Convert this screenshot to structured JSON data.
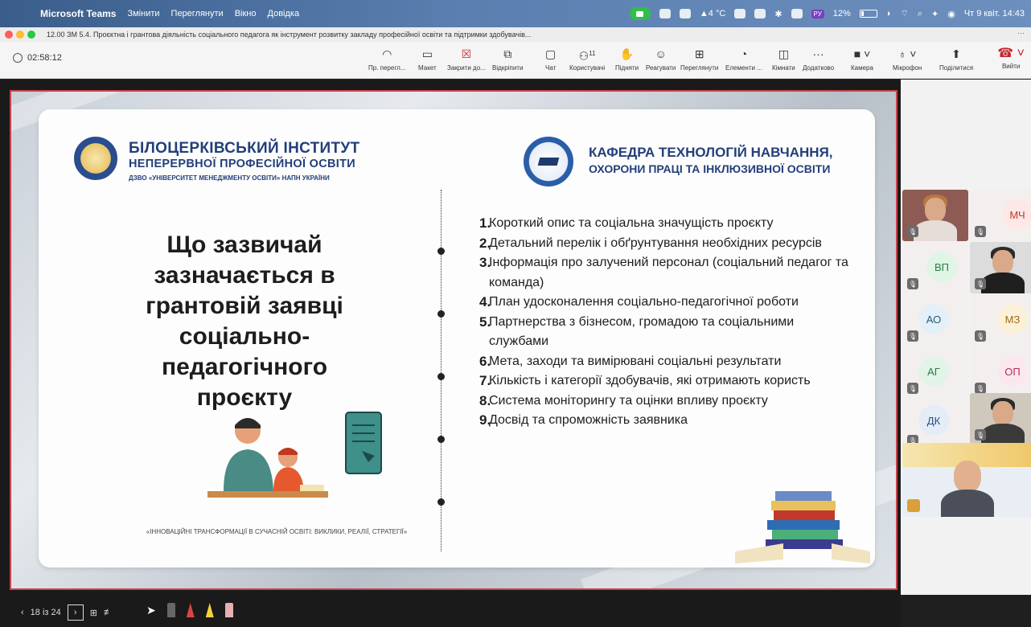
{
  "menubar": {
    "app_name": "Microsoft Teams",
    "menus": [
      "Змінити",
      "Переглянути",
      "Вікно",
      "Довідка"
    ],
    "weather": "▲4 °C",
    "lang": "РУ",
    "battery": "12%",
    "datetime": "Чт 9 квіт. 14:43"
  },
  "window": {
    "title": "12.00 ЗМ 5.4. Проєктна і грантова діяльність соціального педагога як інструмент розвитку закладу професійної освіти та підтримки здобувачів..."
  },
  "toolbar": {
    "timer": "02:58:12",
    "buttons": [
      {
        "label": "Пр. перегл...",
        "icon": "eye-icon"
      },
      {
        "label": "Макет",
        "icon": "layout-icon"
      },
      {
        "label": "Закрити до...",
        "icon": "close-icon"
      },
      {
        "label": "Відкріпити",
        "icon": "unpin-icon"
      },
      {
        "label": "Чат",
        "icon": "chat-icon"
      },
      {
        "label": "Користувачі",
        "icon": "people-icon",
        "count": "11"
      },
      {
        "label": "Підняти",
        "icon": "raise-hand-icon"
      },
      {
        "label": "Реагувати",
        "icon": "smile-icon"
      },
      {
        "label": "Переглянути",
        "icon": "grid-icon"
      },
      {
        "label": "Елементи ...",
        "icon": "apps-icon"
      },
      {
        "label": "Кімнати",
        "icon": "rooms-icon"
      },
      {
        "label": "Додатково",
        "icon": "more-icon"
      },
      {
        "label": "Камера",
        "icon": "camera-icon"
      },
      {
        "label": "Мікрофон",
        "icon": "mic-icon"
      },
      {
        "label": "Поділитися",
        "icon": "share-icon"
      }
    ],
    "leave_label": "Вийти"
  },
  "slide": {
    "institute": {
      "line1": "БІЛОЦЕРКІВСЬКИЙ ІНСТИТУТ",
      "line2": "НЕПЕРЕРВНОЇ ПРОФЕСІЙНОЇ ОСВІТИ",
      "line3": "ДЗВО «УНІВЕРСИТЕТ МЕНЕДЖМЕНТУ ОСВІТИ» НАПН УКРАЇНИ"
    },
    "department": {
      "line1": "КАФЕДРА ТЕХНОЛОГІЙ НАВЧАННЯ,",
      "line2": "ОХОРОНИ ПРАЦІ ТА ІНКЛЮЗИВНОЇ ОСВІТИ"
    },
    "heading": [
      "Що зазвичай",
      "зазначається в",
      "грантовій заявці",
      "соціально-",
      "педагогічного",
      "проєкту"
    ],
    "caption": "«ІННОВАЦІЙНІ ТРАНСФОРМАЦІЇ В СУЧАСНІЙ ОСВІТІ: ВИКЛИКИ, РЕАЛІЇ, СТРАТЕГІЇ»",
    "items": [
      {
        "num": "1.",
        "text": "Короткий опис та соціальна значущість проєкту"
      },
      {
        "num": "2.",
        "text": "Детальний перелік і обґрунтування необхідних ресурсів"
      },
      {
        "num": "3.",
        "text": "Інформація про залучений персонал (соціальний педагог та команда)"
      },
      {
        "num": "4.",
        "text": "План удосконалення соціально-педагогічної роботи"
      },
      {
        "num": "5.",
        "text": "Партнерства з бізнесом, громадою та соціальними службами"
      },
      {
        "num": "6.",
        "text": "Мета, заходи та вимірювані соціальні результати"
      },
      {
        "num": "7.",
        "text": "Кількість і категорії здобувачів, які отримають користь"
      },
      {
        "num": "8.",
        "text": "Система моніторингу та оцінки впливу проєкту"
      },
      {
        "num": "9.",
        "text": "Досвід та спроможність заявника"
      }
    ]
  },
  "participants": [
    {
      "initials": "",
      "type": "video"
    },
    {
      "initials": "МЧ",
      "type": "initials"
    },
    {
      "initials": "ВП",
      "type": "initials"
    },
    {
      "initials": "",
      "type": "video"
    },
    {
      "initials": "АО",
      "type": "initials"
    },
    {
      "initials": "МЗ",
      "type": "initials"
    },
    {
      "initials": "АГ",
      "type": "initials"
    },
    {
      "initials": "ОП",
      "type": "initials"
    },
    {
      "initials": "ДК",
      "type": "initials"
    },
    {
      "initials": "",
      "type": "video"
    }
  ],
  "bottombar": {
    "page_indicator": "18 із 24"
  },
  "colors": {
    "accent_red": "#c9414a",
    "navy": "#233f7a",
    "teams_green": "#2fbf4a"
  }
}
